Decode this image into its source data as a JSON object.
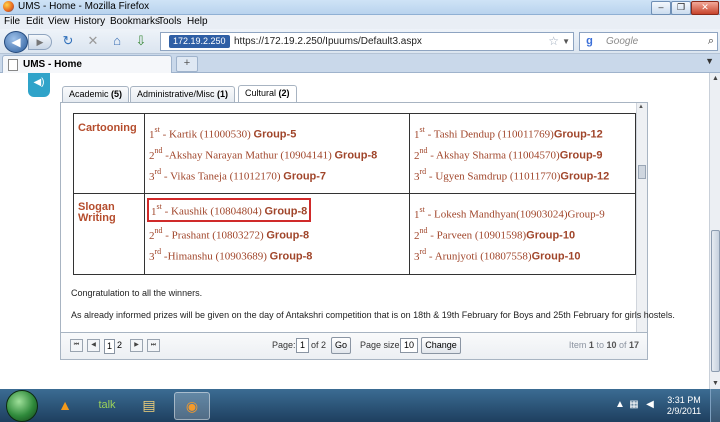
{
  "window": {
    "title": "UMS - Home - Mozilla Firefox"
  },
  "menu": {
    "items": [
      "File",
      "Edit",
      "View",
      "History",
      "Bookmarks",
      "Tools",
      "Help"
    ]
  },
  "nav": {
    "url_identity": "172.19.2.250",
    "url": "https://172.19.2.250/Ipuums/Default3.aspx",
    "search_placeholder": "Google"
  },
  "browser_tab": {
    "title": "UMS - Home",
    "new_tab": "+"
  },
  "page_tabs": [
    {
      "label": "Academic",
      "count": "(5)"
    },
    {
      "label": "Administrative/Misc",
      "count": "(1)"
    },
    {
      "label": "Cultural",
      "count": "(2)"
    }
  ],
  "results": [
    {
      "category": "Cartooning",
      "left": [
        {
          "rank": "1",
          "suffix": "st",
          "name": " - Kartik (11000530) ",
          "group": "Group-5"
        },
        {
          "rank": "2",
          "suffix": "nd",
          "name": " -Akshay Narayan Mathur (10904141) ",
          "group": "Group-8"
        },
        {
          "rank": "3",
          "suffix": "rd",
          "name": " - Vikas Taneja (11012170) ",
          "group": "Group-7"
        }
      ],
      "right": [
        {
          "rank": "1",
          "suffix": "st",
          "name": " - Tashi Dendup (110011769)",
          "group": "Group-12"
        },
        {
          "rank": "2",
          "suffix": "nd",
          "name": " - Akshay Sharma (11004570)",
          "group": "Group-9"
        },
        {
          "rank": "3",
          "suffix": "rd",
          "name": " - Ugyen Samdrup (11011770)",
          "group": "Group-12"
        }
      ]
    },
    {
      "category": "Slogan Writing",
      "left": [
        {
          "rank": "1",
          "suffix": "st",
          "name": " - Kaushik (10804804) ",
          "group": "Group-8"
        },
        {
          "rank": "2",
          "suffix": "nd",
          "name": " - Prashant (10803272) ",
          "group": "Group-8"
        },
        {
          "rank": "3",
          "suffix": "rd",
          "name": " -Himanshu (10903689) ",
          "group": "Group-8"
        }
      ],
      "right": [
        {
          "rank": "1",
          "suffix": "st",
          "name": " - Lokesh Mandhyan(10903024)Group-9",
          "group": ""
        },
        {
          "rank": "2",
          "suffix": "nd",
          "name": " - Parveen (10901598)",
          "group": "Group-10"
        },
        {
          "rank": "3",
          "suffix": "rd",
          "name": " - Arunjyoti (10807558)",
          "group": "Group-10"
        }
      ]
    }
  ],
  "notes": [
    "Congratulation to all the winners.",
    "As already informed prizes will be given on the day of Antakshri competition that is on 18th & 19th February for Boys and 25th February for girls hostels."
  ],
  "pager": {
    "pages": [
      "1",
      "2"
    ],
    "page_label": "Page:",
    "page_value": "1",
    "of_label": "of 2",
    "go_label": "Go",
    "size_label": "Page size:",
    "size_value": "10",
    "change_label": "Change",
    "summary_prefix": "Item ",
    "summary_from": "1",
    "summary_to_label": " to ",
    "summary_to": "10",
    "summary_of_label": " of ",
    "summary_total": "17"
  },
  "taskbar": {
    "time": "3:31 PM",
    "date": "2/9/2011"
  },
  "colors": {
    "accent_text": "#b54d2d",
    "highlight_border": "#d02a2a",
    "taskbar": "#2a5379"
  }
}
